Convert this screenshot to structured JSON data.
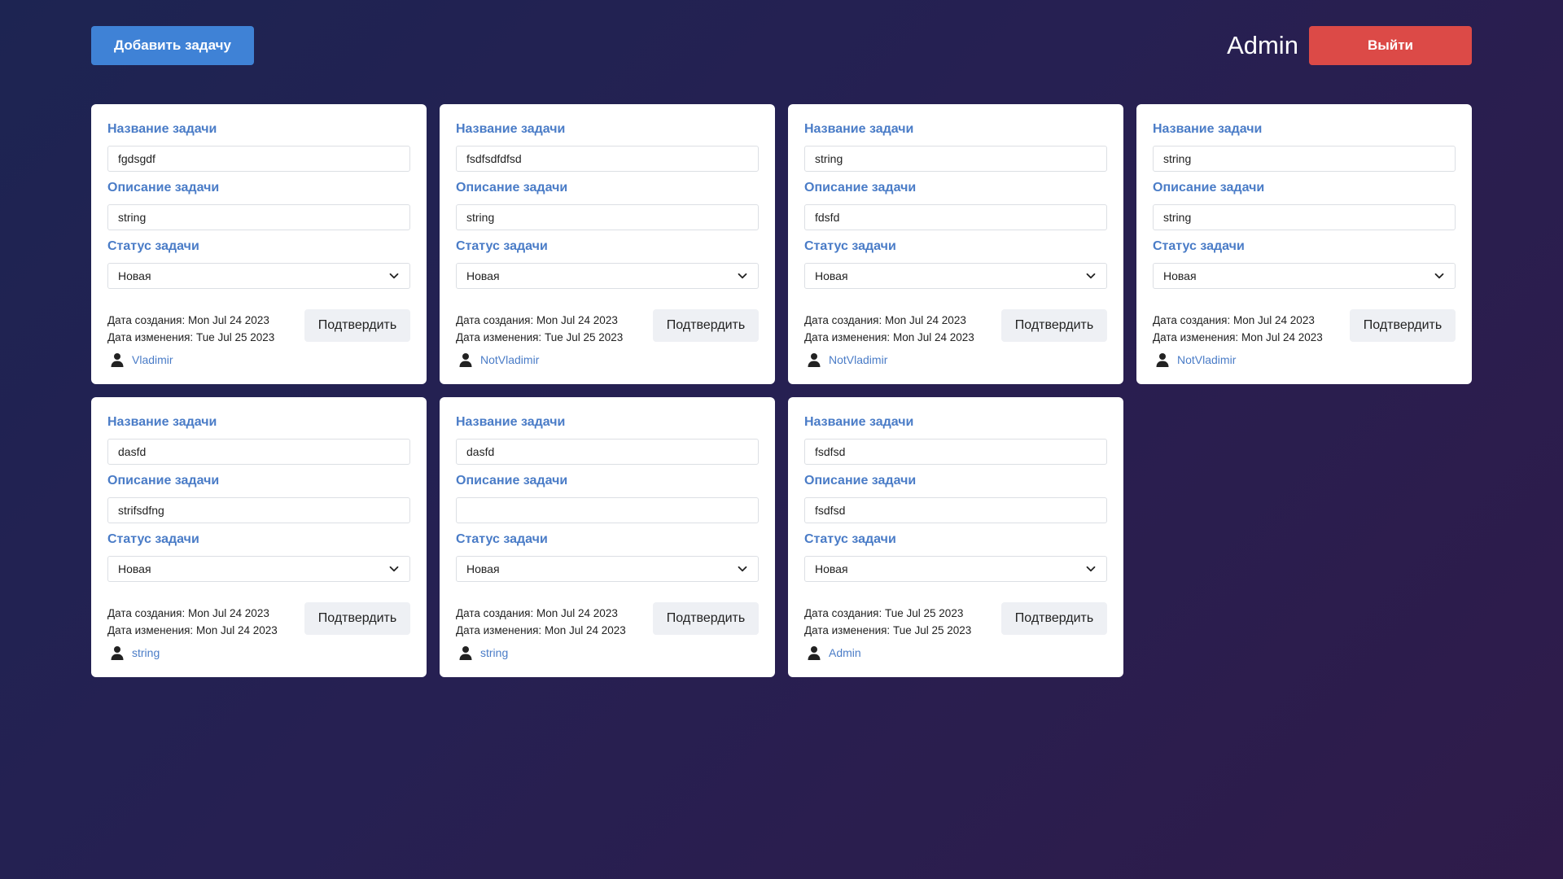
{
  "header": {
    "add_task_label": "Добавить задачу",
    "username": "Admin",
    "logout_label": "Выйти"
  },
  "colors": {
    "primary": "#3f82d6",
    "danger": "#dc4a47",
    "label": "#4a7cc7",
    "background_start": "#1d2452",
    "background_end": "#2f1b4a"
  },
  "labels": {
    "title": "Название задачи",
    "description": "Описание задачи",
    "status": "Статус задачи",
    "created_prefix": "Дата создания:",
    "modified_prefix": "Дата изменения:",
    "confirm": "Подтвердить"
  },
  "icons": {
    "user": "user-icon",
    "chevron": "chevron-down-icon"
  },
  "tasks": [
    {
      "title": "fgdsgdf",
      "description": "string",
      "status": "Новая",
      "created": "Mon Jul 24 2023",
      "modified": "Tue Jul 25 2023",
      "author": "Vladimir"
    },
    {
      "title": "fsdfsdfdfsd",
      "description": "string",
      "status": "Новая",
      "created": "Mon Jul 24 2023",
      "modified": "Tue Jul 25 2023",
      "author": "NotVladimir"
    },
    {
      "title": "string",
      "description": "fdsfd",
      "status": "Новая",
      "created": "Mon Jul 24 2023",
      "modified": "Mon Jul 24 2023",
      "author": "NotVladimir"
    },
    {
      "title": "string",
      "description": "string",
      "status": "Новая",
      "created": "Mon Jul 24 2023",
      "modified": "Mon Jul 24 2023",
      "author": "NotVladimir"
    },
    {
      "title": "dasfd",
      "description": "strifsdfng",
      "status": "Новая",
      "created": "Mon Jul 24 2023",
      "modified": "Mon Jul 24 2023",
      "author": "string"
    },
    {
      "title": "dasfd",
      "description": "",
      "status": "Новая",
      "created": "Mon Jul 24 2023",
      "modified": "Mon Jul 24 2023",
      "author": "string"
    },
    {
      "title": "fsdfsd",
      "description": "fsdfsd",
      "status": "Новая",
      "created": "Tue Jul 25 2023",
      "modified": "Tue Jul 25 2023",
      "author": "Admin"
    }
  ]
}
